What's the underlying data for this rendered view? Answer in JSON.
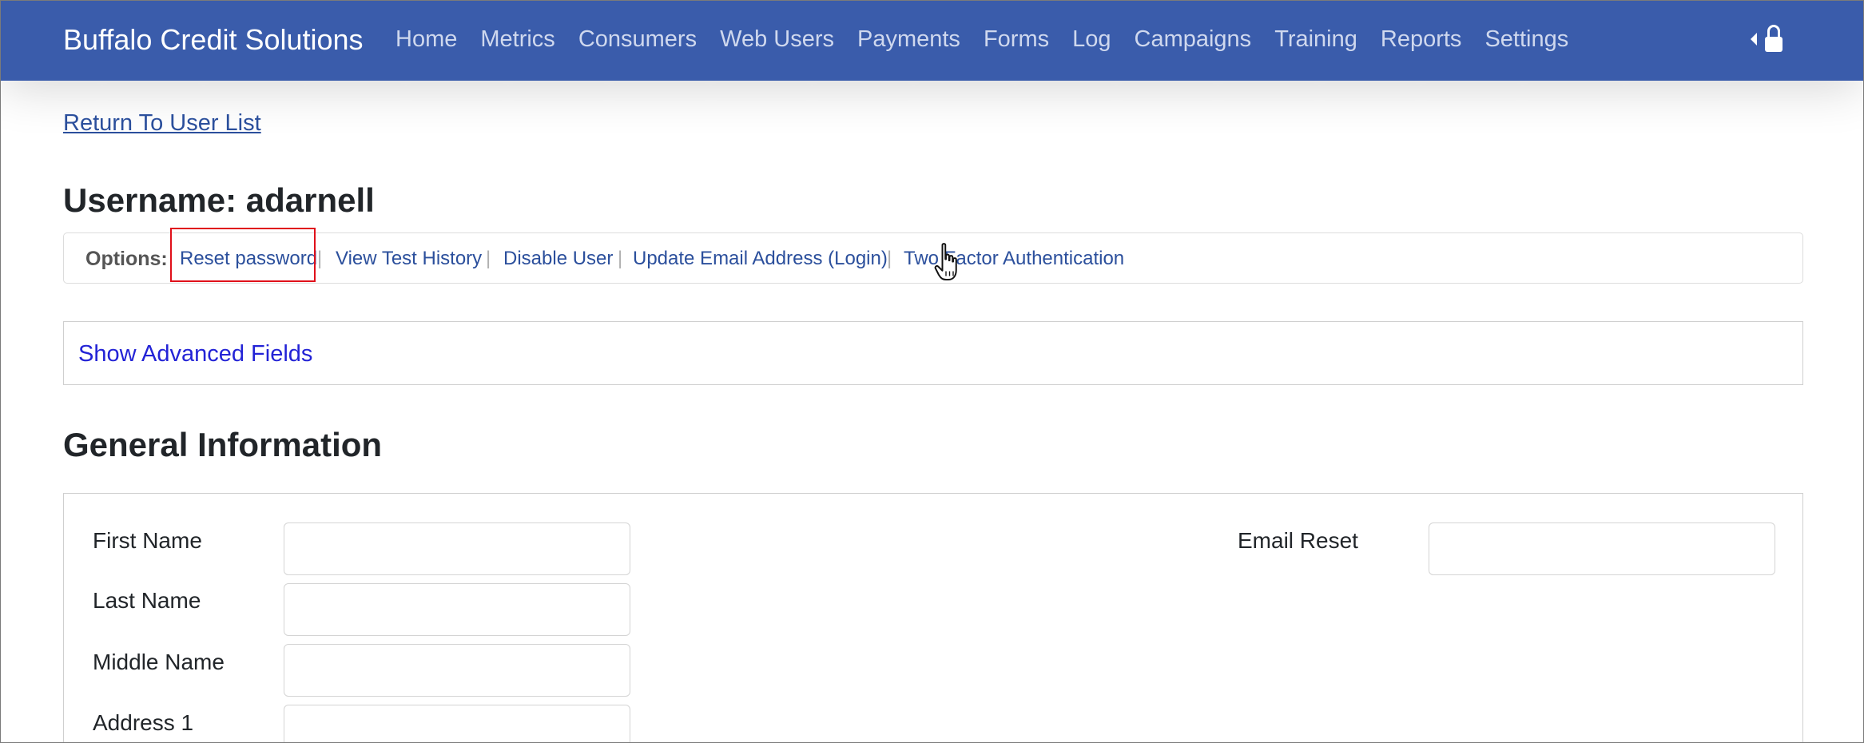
{
  "navbar": {
    "brand": "Buffalo Credit Solutions",
    "items": [
      {
        "label": "Home"
      },
      {
        "label": "Metrics"
      },
      {
        "label": "Consumers"
      },
      {
        "label": "Web Users"
      },
      {
        "label": "Payments"
      },
      {
        "label": "Forms"
      },
      {
        "label": "Log"
      },
      {
        "label": "Campaigns"
      },
      {
        "label": "Training"
      },
      {
        "label": "Reports"
      },
      {
        "label": "Settings"
      }
    ],
    "right_icons": [
      "caret-left-icon",
      "lock-icon"
    ],
    "background_color": "#3a5cab"
  },
  "page": {
    "return_link": "Return To User List",
    "username_heading": "Username: adarnell"
  },
  "options": {
    "label": "Options:",
    "links": [
      {
        "label": "Reset password",
        "highlighted": true
      },
      {
        "label": "View Test History"
      },
      {
        "label": "Disable User"
      },
      {
        "label": "Update Email Address (Login)"
      },
      {
        "label": "Two Factor Authentication"
      }
    ],
    "separator": "|",
    "highlight_color": "#e0101a"
  },
  "advanced": {
    "link": "Show Advanced Fields"
  },
  "general_info": {
    "heading": "General Information",
    "left_fields": [
      {
        "label": "First Name",
        "value": ""
      },
      {
        "label": "Last Name",
        "value": ""
      },
      {
        "label": "Middle Name",
        "value": ""
      },
      {
        "label": "Address 1",
        "value": ""
      }
    ],
    "right_fields": [
      {
        "label": "Email Reset",
        "value": ""
      }
    ]
  },
  "cursor": {
    "icon": "hand-pointer-icon"
  }
}
